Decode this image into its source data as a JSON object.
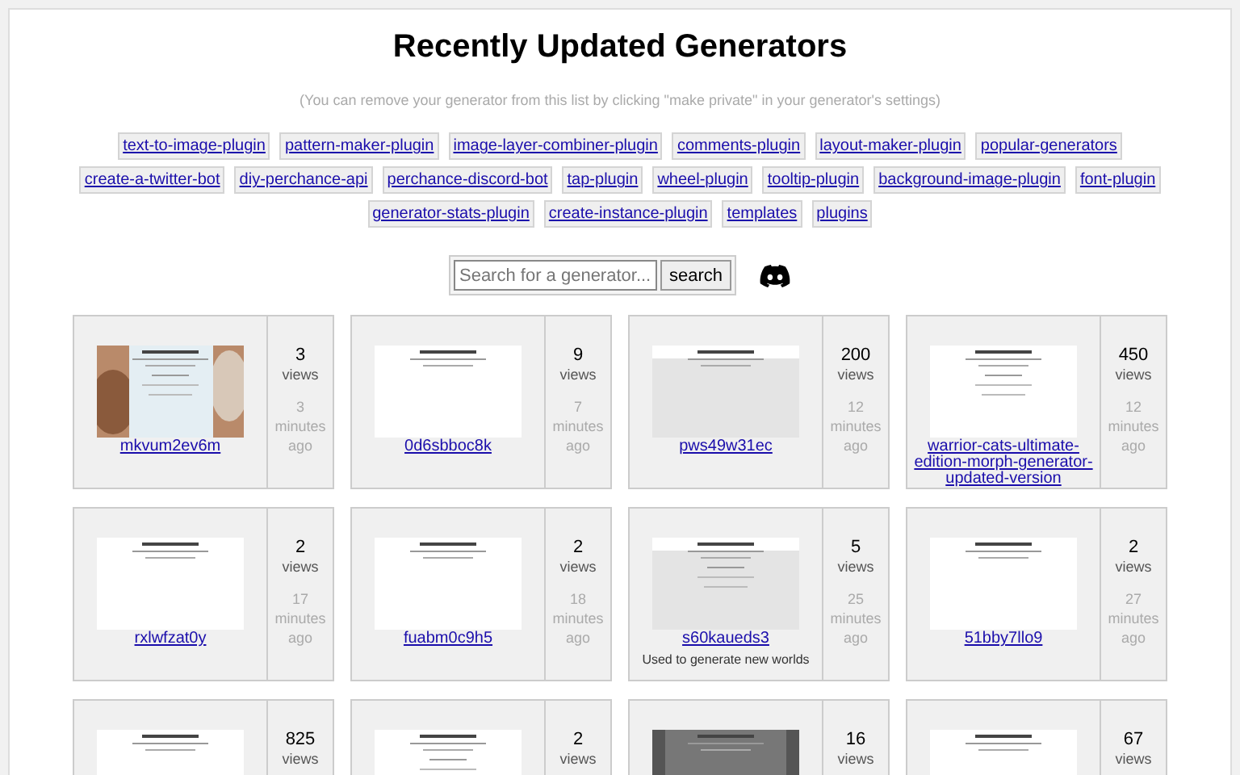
{
  "title": "Recently Updated Generators",
  "note": "(You can remove your generator from this list by clicking \"make private\" in your generator's settings)",
  "tags": [
    "text-to-image-plugin",
    "pattern-maker-plugin",
    "image-layer-combiner-plugin",
    "comments-plugin",
    "layout-maker-plugin",
    "popular-generators",
    "create-a-twitter-bot",
    "diy-perchance-api",
    "perchance-discord-bot",
    "tap-plugin",
    "wheel-plugin",
    "tooltip-plugin",
    "background-image-plugin",
    "font-plugin",
    "generator-stats-plugin",
    "create-instance-plugin",
    "templates",
    "plugins"
  ],
  "search": {
    "placeholder": "Search for a generator...",
    "button": "search"
  },
  "generators": [
    {
      "name": "mkvum2ev6m",
      "count": "3",
      "unit": "views",
      "time": [
        "3",
        "minutes",
        "ago"
      ]
    },
    {
      "name": "0d6sbboc8k",
      "count": "9",
      "unit": "views",
      "time": [
        "7",
        "minutes",
        "ago"
      ]
    },
    {
      "name": "pws49w31ec",
      "count": "200",
      "unit": "views",
      "time": [
        "12",
        "minutes",
        "ago"
      ]
    },
    {
      "name": "warrior-cats-ultimate-edition-morph-generator-updated-version",
      "count": "450",
      "unit": "views",
      "time": [
        "12",
        "minutes",
        "ago"
      ]
    },
    {
      "name": "rxlwfzat0y",
      "count": "2",
      "unit": "views",
      "time": [
        "17",
        "minutes",
        "ago"
      ]
    },
    {
      "name": "fuabm0c9h5",
      "count": "2",
      "unit": "views",
      "time": [
        "18",
        "minutes",
        "ago"
      ]
    },
    {
      "name": "s60kaueds3",
      "description": "Used to generate new worlds",
      "count": "5",
      "unit": "views",
      "time": [
        "25",
        "minutes",
        "ago"
      ]
    },
    {
      "name": "51bby7llo9",
      "count": "2",
      "unit": "views",
      "time": [
        "27",
        "minutes",
        "ago"
      ]
    },
    {
      "count": "825",
      "unit": "views"
    },
    {
      "count": "2",
      "unit": "views"
    },
    {
      "count": "16",
      "unit": "views"
    },
    {
      "count": "67",
      "unit": "views"
    }
  ]
}
